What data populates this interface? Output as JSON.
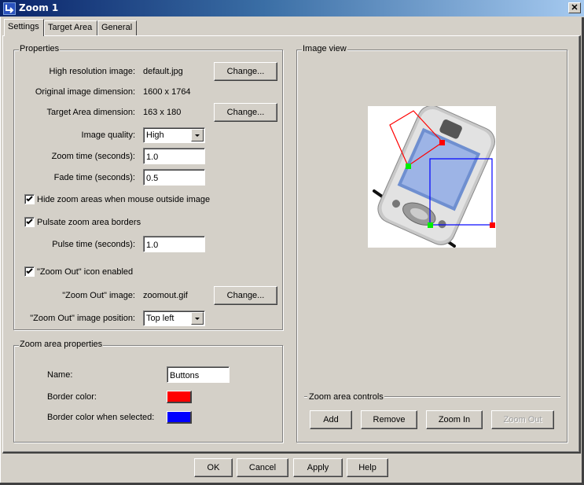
{
  "window": {
    "title": "Zoom 1",
    "close_icon": "close-icon"
  },
  "tabs": [
    {
      "label": "Settings",
      "active": true
    },
    {
      "label": "Target Area",
      "active": false
    },
    {
      "label": "General",
      "active": false
    }
  ],
  "properties": {
    "group_title": "Properties",
    "high_res_label": "High resolution image:",
    "high_res_value": "default.jpg",
    "orig_dim_label": "Original image dimension:",
    "orig_dim_value": "1600 x 1764",
    "target_dim_label": "Target Area dimension:",
    "target_dim_value": "163 x 180",
    "change_label": "Change...",
    "quality_label": "Image quality:",
    "quality_value": "High",
    "zoom_time_label": "Zoom time (seconds):",
    "zoom_time_value": "1.0",
    "fade_time_label": "Fade time (seconds):",
    "fade_time_value": "0.5",
    "hide_zoom_label": "Hide zoom areas when mouse outside image",
    "hide_zoom_checked": true,
    "pulsate_label": "Pulsate zoom area borders",
    "pulsate_checked": true,
    "pulse_time_label": "Pulse time (seconds):",
    "pulse_time_value": "1.0",
    "zoomout_icon_label": "\"Zoom Out\" icon enabled",
    "zoomout_icon_checked": true,
    "zoomout_image_label": "\"Zoom Out\" image:",
    "zoomout_image_value": "zoomout.gif",
    "zoomout_pos_label": "\"Zoom Out\" image position:",
    "zoomout_pos_value": "Top left"
  },
  "zoom_area": {
    "group_title": "Zoom area properties",
    "name_label": "Name:",
    "name_value": "Buttons",
    "border_color_label": "Border color:",
    "border_color": "#ff0000",
    "selected_color_label": "Border color when selected:",
    "selected_color": "#0000ff"
  },
  "image_view": {
    "group_title": "Image view",
    "controls_title": "Zoom area controls",
    "buttons": {
      "add": "Add",
      "remove": "Remove",
      "zoom_in": "Zoom In",
      "zoom_out": "Zoom Out"
    },
    "zoom_out_enabled": false
  },
  "footer": {
    "ok": "OK",
    "cancel": "Cancel",
    "apply": "Apply",
    "help": "Help"
  }
}
